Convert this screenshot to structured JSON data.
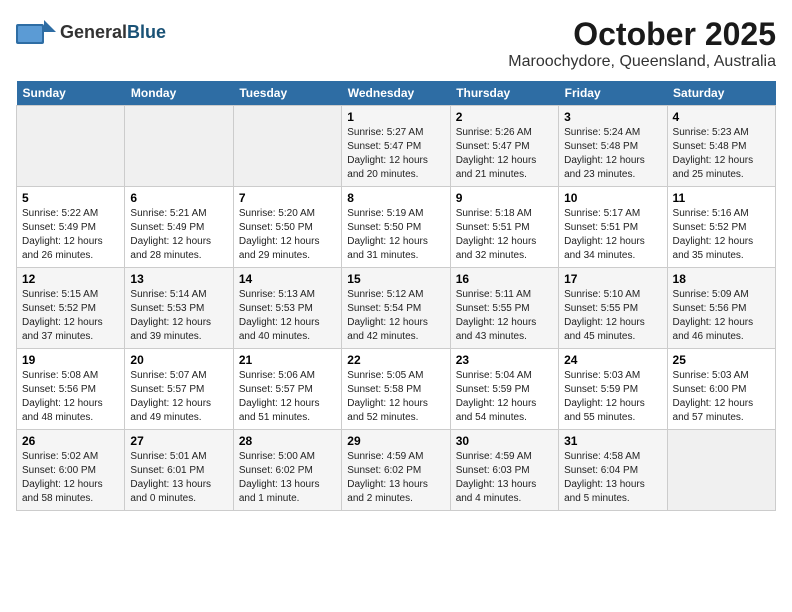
{
  "logo": {
    "general": "General",
    "blue": "Blue"
  },
  "title": "October 2025",
  "location": "Maroochydore, Queensland, Australia",
  "weekdays": [
    "Sunday",
    "Monday",
    "Tuesday",
    "Wednesday",
    "Thursday",
    "Friday",
    "Saturday"
  ],
  "weeks": [
    [
      {
        "day": "",
        "info": ""
      },
      {
        "day": "",
        "info": ""
      },
      {
        "day": "",
        "info": ""
      },
      {
        "day": "1",
        "info": "Sunrise: 5:27 AM\nSunset: 5:47 PM\nDaylight: 12 hours\nand 20 minutes."
      },
      {
        "day": "2",
        "info": "Sunrise: 5:26 AM\nSunset: 5:47 PM\nDaylight: 12 hours\nand 21 minutes."
      },
      {
        "day": "3",
        "info": "Sunrise: 5:24 AM\nSunset: 5:48 PM\nDaylight: 12 hours\nand 23 minutes."
      },
      {
        "day": "4",
        "info": "Sunrise: 5:23 AM\nSunset: 5:48 PM\nDaylight: 12 hours\nand 25 minutes."
      }
    ],
    [
      {
        "day": "5",
        "info": "Sunrise: 5:22 AM\nSunset: 5:49 PM\nDaylight: 12 hours\nand 26 minutes."
      },
      {
        "day": "6",
        "info": "Sunrise: 5:21 AM\nSunset: 5:49 PM\nDaylight: 12 hours\nand 28 minutes."
      },
      {
        "day": "7",
        "info": "Sunrise: 5:20 AM\nSunset: 5:50 PM\nDaylight: 12 hours\nand 29 minutes."
      },
      {
        "day": "8",
        "info": "Sunrise: 5:19 AM\nSunset: 5:50 PM\nDaylight: 12 hours\nand 31 minutes."
      },
      {
        "day": "9",
        "info": "Sunrise: 5:18 AM\nSunset: 5:51 PM\nDaylight: 12 hours\nand 32 minutes."
      },
      {
        "day": "10",
        "info": "Sunrise: 5:17 AM\nSunset: 5:51 PM\nDaylight: 12 hours\nand 34 minutes."
      },
      {
        "day": "11",
        "info": "Sunrise: 5:16 AM\nSunset: 5:52 PM\nDaylight: 12 hours\nand 35 minutes."
      }
    ],
    [
      {
        "day": "12",
        "info": "Sunrise: 5:15 AM\nSunset: 5:52 PM\nDaylight: 12 hours\nand 37 minutes."
      },
      {
        "day": "13",
        "info": "Sunrise: 5:14 AM\nSunset: 5:53 PM\nDaylight: 12 hours\nand 39 minutes."
      },
      {
        "day": "14",
        "info": "Sunrise: 5:13 AM\nSunset: 5:53 PM\nDaylight: 12 hours\nand 40 minutes."
      },
      {
        "day": "15",
        "info": "Sunrise: 5:12 AM\nSunset: 5:54 PM\nDaylight: 12 hours\nand 42 minutes."
      },
      {
        "day": "16",
        "info": "Sunrise: 5:11 AM\nSunset: 5:55 PM\nDaylight: 12 hours\nand 43 minutes."
      },
      {
        "day": "17",
        "info": "Sunrise: 5:10 AM\nSunset: 5:55 PM\nDaylight: 12 hours\nand 45 minutes."
      },
      {
        "day": "18",
        "info": "Sunrise: 5:09 AM\nSunset: 5:56 PM\nDaylight: 12 hours\nand 46 minutes."
      }
    ],
    [
      {
        "day": "19",
        "info": "Sunrise: 5:08 AM\nSunset: 5:56 PM\nDaylight: 12 hours\nand 48 minutes."
      },
      {
        "day": "20",
        "info": "Sunrise: 5:07 AM\nSunset: 5:57 PM\nDaylight: 12 hours\nand 49 minutes."
      },
      {
        "day": "21",
        "info": "Sunrise: 5:06 AM\nSunset: 5:57 PM\nDaylight: 12 hours\nand 51 minutes."
      },
      {
        "day": "22",
        "info": "Sunrise: 5:05 AM\nSunset: 5:58 PM\nDaylight: 12 hours\nand 52 minutes."
      },
      {
        "day": "23",
        "info": "Sunrise: 5:04 AM\nSunset: 5:59 PM\nDaylight: 12 hours\nand 54 minutes."
      },
      {
        "day": "24",
        "info": "Sunrise: 5:03 AM\nSunset: 5:59 PM\nDaylight: 12 hours\nand 55 minutes."
      },
      {
        "day": "25",
        "info": "Sunrise: 5:03 AM\nSunset: 6:00 PM\nDaylight: 12 hours\nand 57 minutes."
      }
    ],
    [
      {
        "day": "26",
        "info": "Sunrise: 5:02 AM\nSunset: 6:00 PM\nDaylight: 12 hours\nand 58 minutes."
      },
      {
        "day": "27",
        "info": "Sunrise: 5:01 AM\nSunset: 6:01 PM\nDaylight: 13 hours\nand 0 minutes."
      },
      {
        "day": "28",
        "info": "Sunrise: 5:00 AM\nSunset: 6:02 PM\nDaylight: 13 hours\nand 1 minute."
      },
      {
        "day": "29",
        "info": "Sunrise: 4:59 AM\nSunset: 6:02 PM\nDaylight: 13 hours\nand 2 minutes."
      },
      {
        "day": "30",
        "info": "Sunrise: 4:59 AM\nSunset: 6:03 PM\nDaylight: 13 hours\nand 4 minutes."
      },
      {
        "day": "31",
        "info": "Sunrise: 4:58 AM\nSunset: 6:04 PM\nDaylight: 13 hours\nand 5 minutes."
      },
      {
        "day": "",
        "info": ""
      }
    ]
  ]
}
